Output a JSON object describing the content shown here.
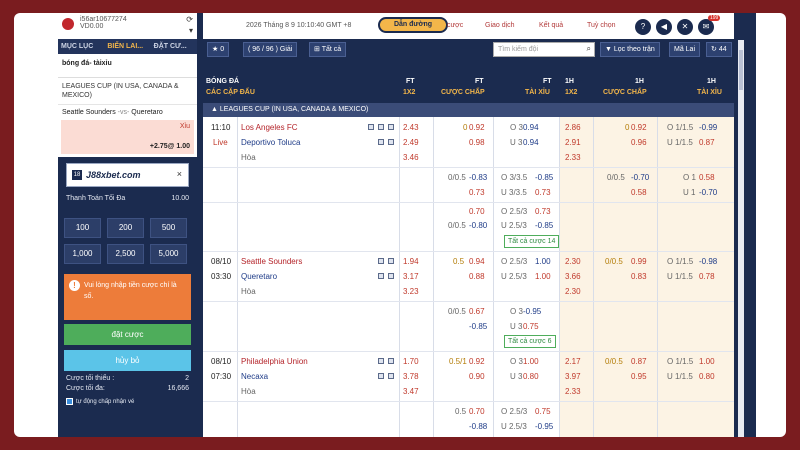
{
  "account": {
    "id": "i56ar10677274",
    "balance": "VD0.00"
  },
  "left_tabs": [
    "MỤC LỤC",
    "BIỂN LAI...",
    "ĐẶT CƯ..."
  ],
  "slip": {
    "title": "bóng đá- tàixỉu",
    "league": "LEAGUES CUP (IN USA, CANADA & MEXICO)",
    "home": "Seattle Sounders",
    "vs": "-vs-",
    "away": "Queretaro",
    "side": "Xỉu",
    "pick": "+2.75@ 1.00"
  },
  "promo": {
    "tag": "18",
    "text": "J88xbet.com",
    "close": "×"
  },
  "max_pay": {
    "label": "Thanh Toán Tối Đa",
    "value": "10.00"
  },
  "amounts": [
    "100",
    "200",
    "500",
    "1,000",
    "2,500",
    "5,000"
  ],
  "warning": "Vui lòng nhập tiền cược chí là số.",
  "bet_button": "đặt cược",
  "cancel_button": "hủy bỏ",
  "limits": {
    "min_label": "Cược tối thiểu :",
    "min_value": "2",
    "max_label": "Cược tối đa:",
    "max_value": "16,666"
  },
  "auto_accept": "tự động chấp nhận vé",
  "topbar": {
    "clock": "2026 Tháng 8 9 10:10:40 GMT +8",
    "guide": "Dẫn đường",
    "nav": [
      "cược",
      "Giao dịch",
      "Kết quả",
      "Tuỳ chọn"
    ],
    "badge": "199"
  },
  "toolbar": {
    "star_count": "0",
    "leagues": "( 96 / 96 ) Giải",
    "all": "Tất cả",
    "search_placeholder": "Tìm kiếm đội",
    "follow": "Lọc theo trận",
    "refresh": "Mã Lai",
    "count": "44"
  },
  "headers": {
    "sport": "BÓNG ĐÁ",
    "subsport": "CÁC CẶP ĐẤU",
    "ft1": "FT",
    "ft1s": "1X2",
    "ft2": "FT",
    "ft2s": "CƯỢC CHẤP",
    "ft3": "FT",
    "ft3s": "TÀI XỈU",
    "h1a": "1H",
    "h1as": "1X2",
    "h1b": "1H",
    "h1bs": "CƯỢC CHẤP",
    "h1c": "1H",
    "h1cs": "TÀI XỈU"
  },
  "league": "LEAGUES CUP (IN USA, CANADA & MEXICO)",
  "matches": [
    {
      "time": "11:10",
      "status": "Live",
      "home": "Los Angeles FC",
      "away": "Deportivo Toluca",
      "draw": "Hòa",
      "ft1x2": [
        "2.43",
        "2.49",
        "3.46"
      ],
      "ft_hdp": [
        "0",
        "0.92",
        "",
        "0.98"
      ],
      "ft_ou": [
        "O 3",
        "0.94",
        "U 3",
        "0.94"
      ],
      "h1_1x2": [
        "2.86",
        "2.91",
        "2.33"
      ],
      "h1_hdp": [
        "0",
        "0.92",
        "",
        "0.96"
      ],
      "h1_ou": [
        "O 1/1.5",
        "-0.99",
        "U 1/1.5",
        "0.87"
      ],
      "extra": [
        {
          "hdp": [
            "0/0.5",
            "-0.83",
            "",
            "0.73"
          ],
          "ou": [
            "O 3/3.5",
            "-0.85",
            "U 3/3.5",
            "0.73"
          ],
          "h1hdp": [
            "0/0.5",
            "-0.70",
            "",
            "0.58"
          ],
          "h1ou": [
            "O 1",
            "0.58",
            "U 1",
            "-0.70"
          ]
        },
        {
          "hdp": [
            "",
            "0.70",
            "0/0.5",
            "-0.80"
          ],
          "ou": [
            "O 2.5/3",
            "0.73",
            "U 2.5/3",
            "-0.85"
          ]
        }
      ],
      "more": "Tất cả cược 14"
    },
    {
      "time": "08/10",
      "status": "03:30",
      "home": "Seattle Sounders",
      "away": "Queretaro",
      "draw": "Hòa",
      "ft1x2": [
        "1.94",
        "3.17",
        "3.23"
      ],
      "ft_hdp": [
        "0.5",
        "0.94",
        "",
        "0.88"
      ],
      "ft_ou": [
        "O 2.5/3",
        "1.00",
        "U 2.5/3",
        "1.00"
      ],
      "h1_1x2": [
        "2.30",
        "3.66",
        "2.30"
      ],
      "h1_hdp": [
        "0/0.5",
        "0.99",
        "",
        "0.83"
      ],
      "h1_ou": [
        "O 1/1.5",
        "-0.98",
        "U 1/1.5",
        "0.78"
      ],
      "extra": [
        {
          "hdp": [
            "0/0.5",
            "0.67",
            "",
            "-0.85"
          ],
          "ou": [
            "O 3",
            "-0.95",
            "U 3",
            "0.75"
          ]
        }
      ],
      "more": "Tất cả cược 6"
    },
    {
      "time": "08/10",
      "status": "07:30",
      "home": "Philadelphia Union",
      "away": "Necaxa",
      "draw": "Hòa",
      "ft1x2": [
        "1.70",
        "3.78",
        "3.47"
      ],
      "ft_hdp": [
        "0.5/1",
        "0.92",
        "",
        "0.90"
      ],
      "ft_ou": [
        "O 3",
        "1.00",
        "U 3",
        "0.80"
      ],
      "h1_1x2": [
        "2.17",
        "3.97",
        "2.33"
      ],
      "h1_hdp": [
        "0/0.5",
        "0.87",
        "",
        "0.95"
      ],
      "h1_ou": [
        "O 1/1.5",
        "1.00",
        "U 1/1.5",
        "0.80"
      ],
      "extra": [
        {
          "hdp": [
            "0.5",
            "0.70",
            "",
            "-0.88"
          ],
          "ou": [
            "O 2.5/3",
            "0.75",
            "U 2.5/3",
            "-0.95"
          ]
        }
      ]
    }
  ]
}
